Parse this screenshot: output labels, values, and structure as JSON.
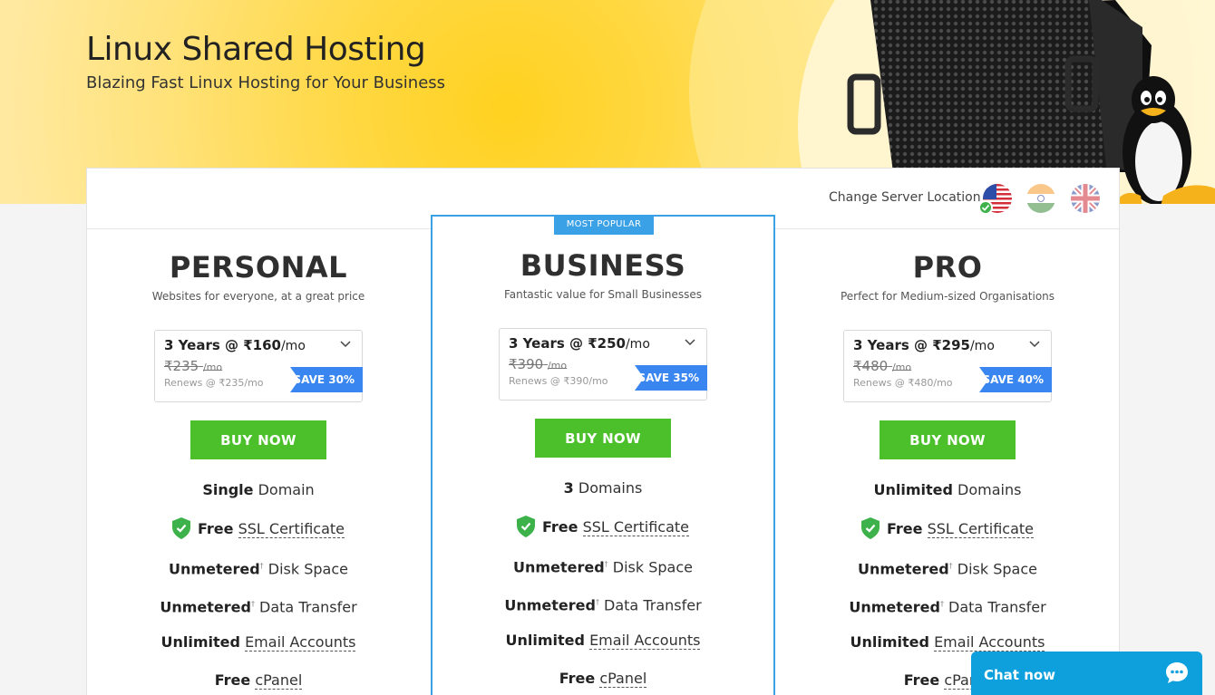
{
  "hero": {
    "title": "Linux Shared Hosting",
    "subtitle": "Blazing Fast Linux Hosting for Your Business"
  },
  "location": {
    "label": "Change Server Location",
    "flags": [
      "us-flag-icon",
      "india-flag-icon",
      "uk-flag-icon"
    ],
    "selected": "us"
  },
  "plans": [
    {
      "name": "PERSONAL",
      "tagline": "Websites for everyone, at a great price",
      "term": "3 Years @ ₹160",
      "per": "/mo",
      "old_price": "₹235",
      "old_per": "/mo",
      "renews": "Renews @ ₹235/mo",
      "save": "SAVE 30%",
      "buy": "BUY NOW",
      "domains_bold": "Single",
      "domains_rest": " Domain"
    },
    {
      "badge": "MOST POPULAR",
      "name": "BUSINESS",
      "tagline": "Fantastic value for Small Businesses",
      "term": "3 Years @ ₹250",
      "per": "/mo",
      "old_price": "₹390",
      "old_per": "/mo",
      "renews": "Renews @ ₹390/mo",
      "save": "SAVE 35%",
      "buy": "BUY NOW",
      "domains_bold": "3",
      "domains_rest": " Domains"
    },
    {
      "name": "PRO",
      "tagline": "Perfect for Medium-sized Organisations",
      "term": "3 Years @ ₹295",
      "per": "/mo",
      "old_price": "₹480",
      "old_per": "/mo",
      "renews": "Renews @ ₹480/mo",
      "save": "SAVE 40%",
      "buy": "BUY NOW",
      "domains_bold": "Unlimited",
      "domains_rest": " Domains"
    }
  ],
  "features": {
    "ssl_bold": "Free",
    "ssl_link": "SSL Certificate",
    "disk_bold": "Unmetered",
    "dagger": "†",
    "disk_rest": " Disk Space",
    "transfer_rest": " Data Transfer",
    "email_bold": "Unlimited",
    "email_link": "Email Accounts",
    "cpanel_bold": "Free",
    "cpanel_link": "cPanel"
  },
  "chat": {
    "label": "Chat now"
  },
  "colors": {
    "accent_blue": "#3aa1e6",
    "buy_green": "#4cc02b",
    "save_blue": "#3a86f0",
    "chat_blue": "#0ea0dc",
    "hero_yellow": "#ffd842"
  }
}
